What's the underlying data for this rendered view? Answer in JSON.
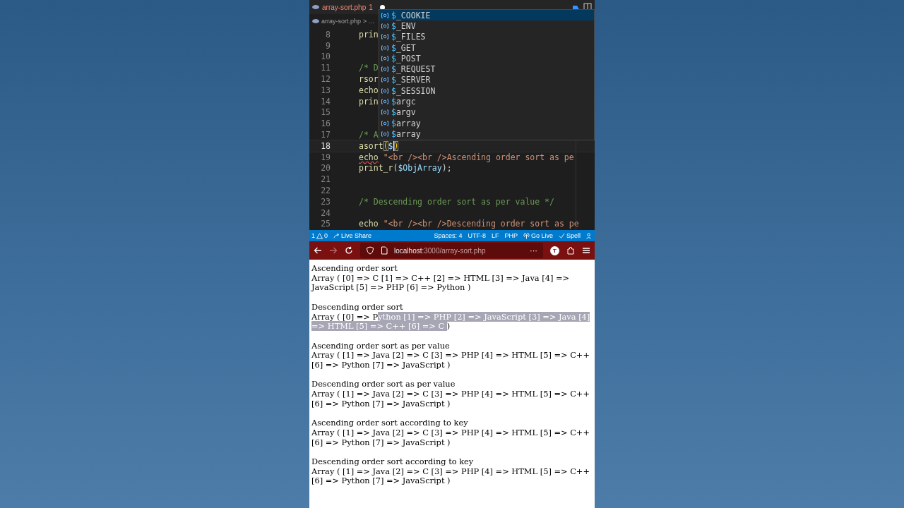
{
  "editor": {
    "tab": {
      "title": "array-sort.php",
      "problems": "1",
      "modified": true
    },
    "breadcrumb": {
      "file": "array-sort.php",
      "separator": ">",
      "rest": "..."
    },
    "lines": [
      {
        "number": "8",
        "current": false,
        "tokens": [
          {
            "text": "prin",
            "kind": "fn"
          }
        ]
      },
      {
        "number": "9",
        "current": false
      },
      {
        "number": "10",
        "current": false
      },
      {
        "number": "11",
        "current": false,
        "tokens": [
          {
            "text": "/* D",
            "kind": "comment"
          }
        ]
      },
      {
        "number": "12",
        "current": false,
        "tokens": [
          {
            "text": "rsor",
            "kind": "fn"
          }
        ]
      },
      {
        "number": "13",
        "current": false,
        "tokens": [
          {
            "text": "echo",
            "kind": "fn"
          }
        ]
      },
      {
        "number": "14",
        "current": false,
        "tokens": [
          {
            "text": "prin",
            "kind": "fn"
          }
        ]
      },
      {
        "number": "15",
        "current": false
      },
      {
        "number": "16",
        "current": false
      },
      {
        "number": "17",
        "current": false,
        "tokens": [
          {
            "text": "/* A",
            "kind": "comment"
          }
        ]
      },
      {
        "number": "18",
        "current": true,
        "tokens": [
          {
            "text": "asort",
            "kind": "fn"
          },
          {
            "text": "(",
            "kind": "bracket"
          },
          {
            "text": "$",
            "kind": "var",
            "cursor": true
          },
          {
            "text": ")",
            "kind": "bracket"
          }
        ]
      },
      {
        "number": "19",
        "current": false,
        "tokens": [
          {
            "text": "echo",
            "kind": "fn",
            "error": true
          },
          {
            "text": "\"<br /><br />Ascending order sort as pe",
            "kind": "string"
          }
        ]
      },
      {
        "number": "20",
        "current": false,
        "tokens": [
          {
            "text": "print_r",
            "kind": "fn"
          },
          {
            "text": "(",
            "kind": "punct"
          },
          {
            "text": "$ObjArray",
            "kind": "var"
          },
          {
            "text": ");",
            "kind": "punct"
          }
        ]
      },
      {
        "number": "21",
        "current": false
      },
      {
        "number": "22",
        "current": false
      },
      {
        "number": "23",
        "current": false,
        "tokens": [
          {
            "text": "/* Descending order sort as per value */",
            "kind": "comment"
          }
        ]
      },
      {
        "number": "24",
        "current": false
      },
      {
        "number": "25",
        "current": false,
        "tokens": [
          {
            "text": "echo",
            "kind": "fn"
          },
          {
            "text": "\"<br /><br />Descending order sort as pe",
            "kind": "string"
          }
        ]
      }
    ],
    "suggestions": [
      {
        "prefix": "$",
        "label": "_COOKIE",
        "selected": true
      },
      {
        "prefix": "$",
        "label": "_ENV",
        "selected": false
      },
      {
        "prefix": "$",
        "label": "_FILES",
        "selected": false
      },
      {
        "prefix": "$",
        "label": "_GET",
        "selected": false
      },
      {
        "prefix": "$",
        "label": "_POST",
        "selected": false
      },
      {
        "prefix": "$",
        "label": "_REQUEST",
        "selected": false
      },
      {
        "prefix": "$",
        "label": "_SERVER",
        "selected": false
      },
      {
        "prefix": "$",
        "label": "_SESSION",
        "selected": false
      },
      {
        "prefix": "$",
        "label": "argc",
        "selected": false
      },
      {
        "prefix": "$",
        "label": "argv",
        "selected": false
      },
      {
        "prefix": "$",
        "label": "array",
        "selected": false
      },
      {
        "prefix": "$",
        "label": "array",
        "selected": false
      }
    ]
  },
  "status_bar": {
    "errors": "1",
    "warnings": "0",
    "live_share": "Live Share",
    "items": [
      "Spaces: 4",
      "UTF-8",
      "LF",
      "PHP"
    ],
    "go_live": "Go Live",
    "spell": "Spell"
  },
  "browser": {
    "url_host": "localhost",
    "url_path": ":3000/array-sort.php",
    "more": "···",
    "avatar": "T",
    "output": [
      {
        "heading": "Ascending order sort",
        "parts": [
          {
            "text": "Array ( [0] => C [1] => C++ [2] => HTML [3] => Java [4] => JavaScript [5] => PHP [6] => Python )",
            "selected": false
          }
        ]
      },
      {
        "heading": "Descending order sort",
        "parts": [
          {
            "text": "Array ( [0] => P",
            "selected": false
          },
          {
            "text": "ython [1] => PHP [2] => JavaScript [3] => Java [4] => HTML [5] => C++ [6] => C ",
            "selected": true
          },
          {
            "text": ")",
            "selected": false
          }
        ]
      },
      {
        "heading": "Ascending order sort as per value",
        "parts": [
          {
            "text": "Array ( [1] => Java [2] => C [3] => PHP [4] => HTML [5] => C++ [6] => Python [7] => JavaScript )",
            "selected": false
          }
        ]
      },
      {
        "heading": "Descending order sort as per value",
        "parts": [
          {
            "text": "Array ( [1] => Java [2] => C [3] => PHP [4] => HTML [5] => C++ [6] => Python [7] => JavaScript )",
            "selected": false
          }
        ]
      },
      {
        "heading": "Ascending order sort according to key",
        "parts": [
          {
            "text": "Array ( [1] => Java [2] => C [3] => PHP [4] => HTML [5] => C++ [6] => Python [7] => JavaScript )",
            "selected": false
          }
        ]
      },
      {
        "heading": "Descending order sort according to key",
        "parts": [
          {
            "text": "Array ( [1] => Java [2] => C [3] => PHP [4] => HTML [5] => C++ [6] => Python [7] => JavaScript )",
            "selected": false
          }
        ]
      }
    ]
  }
}
